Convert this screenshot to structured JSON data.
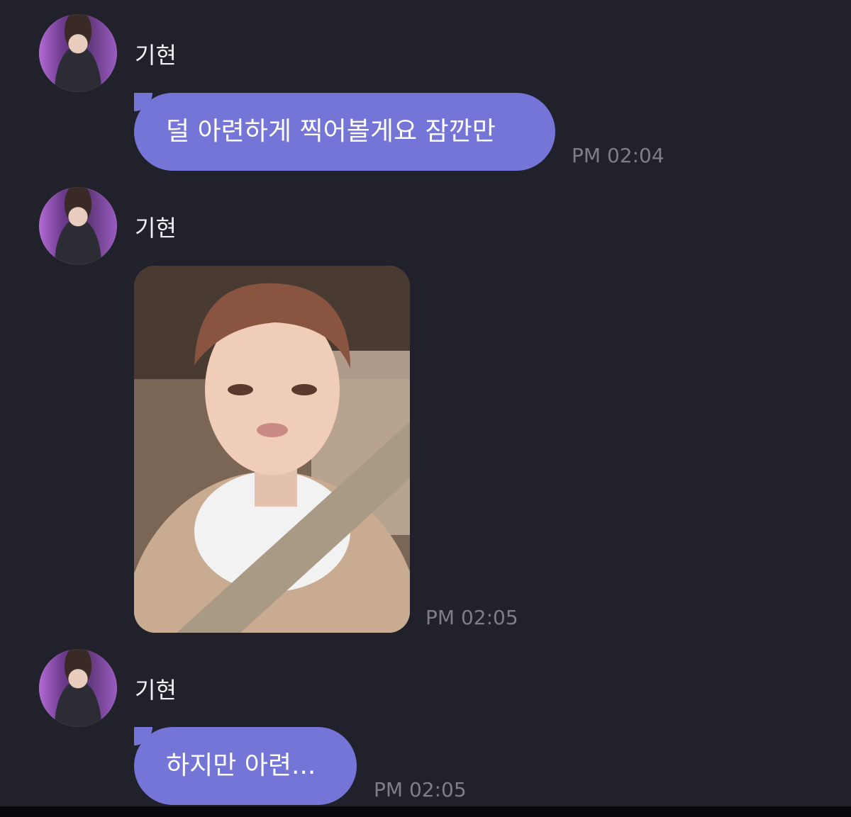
{
  "colors": {
    "background": "#20212a",
    "bubble": "#7475d6",
    "timestamp": "#7d7e88",
    "sender_name": "#f2f2f5"
  },
  "messages": [
    {
      "sender": "기현",
      "type": "text",
      "text": "덜 아련하게 찍어볼게요 잠깐만",
      "time": "PM 02:04"
    },
    {
      "sender": "기현",
      "type": "photo",
      "photo_icon": "selfie-photo",
      "time": "PM 02:05"
    },
    {
      "sender": "기현",
      "type": "text",
      "text": "하지만 아련...",
      "time": "PM 02:05"
    }
  ]
}
